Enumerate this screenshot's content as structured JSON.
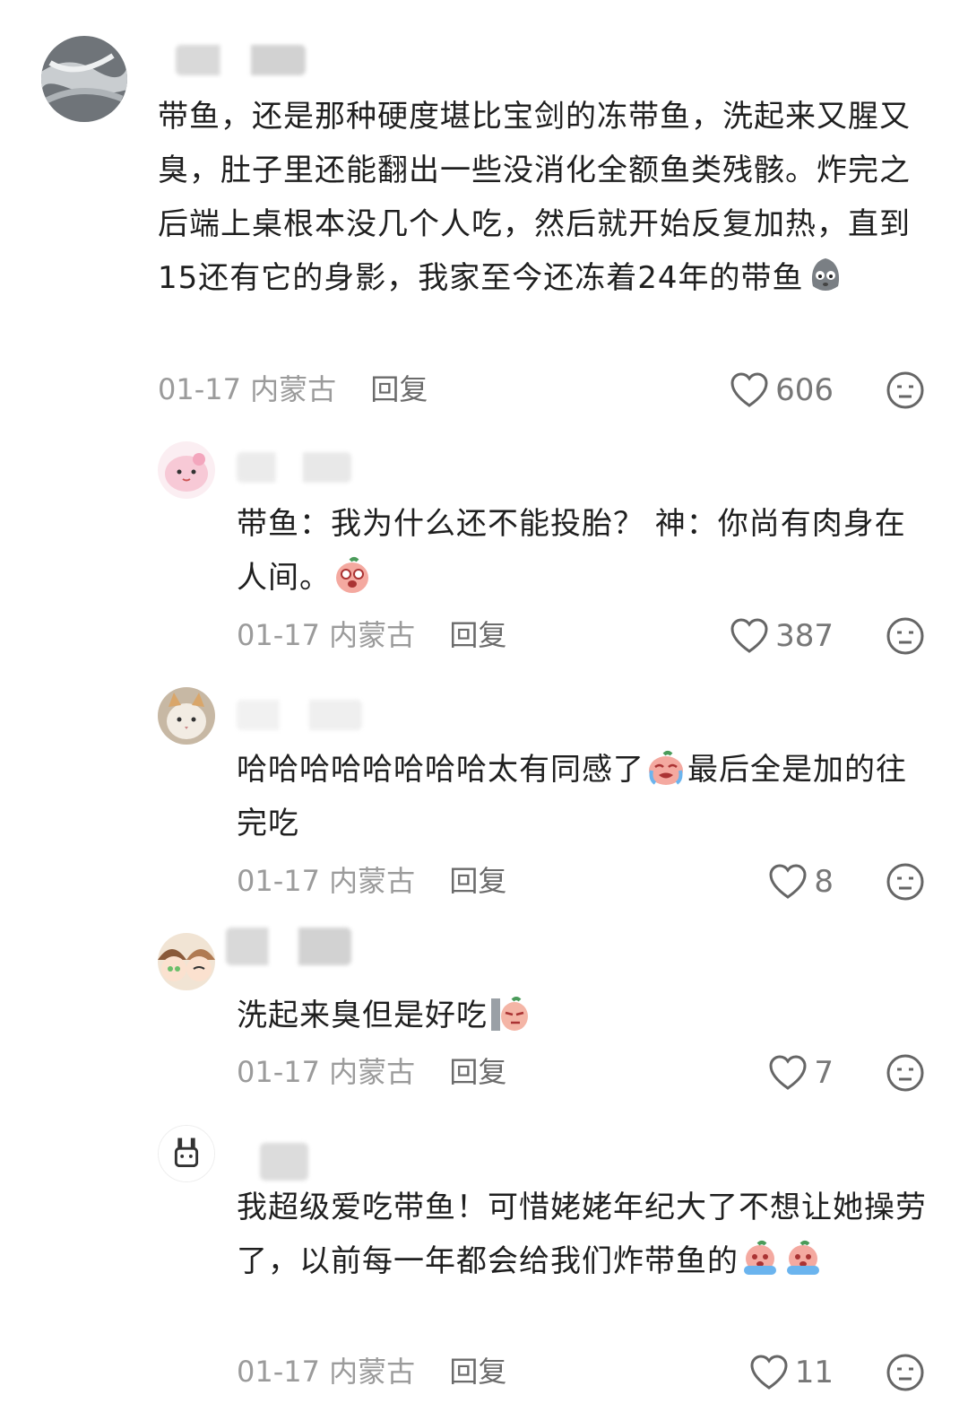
{
  "comments": [
    {
      "text_before": "带鱼，还是那种硬度堪比宝剑的冻带鱼，洗起来又腥又臭，肚子里还能翻出一些没消化全额鱼类残骸。炸完之后端上桌根本没几个人吃，然后就开始反复加热，直到15还有它的身影，我家至今还冻着24年的带鱼",
      "emoji": "worried-face",
      "date": "01-17",
      "location": "内蒙古",
      "reply_label": "回复",
      "likes": "606"
    },
    {
      "text_before": "带鱼：我为什么还不能投胎？ 神：你尚有肉身在人间。",
      "emoji": "shocked-face",
      "date": "01-17",
      "location": "内蒙古",
      "reply_label": "回复",
      "likes": "387"
    },
    {
      "text_before": "哈哈哈哈哈哈哈哈太有同感了",
      "emoji": "crying-face",
      "text_after": "最后全是加的往完吃",
      "date": "01-17",
      "location": "内蒙古",
      "reply_label": "回复",
      "likes": "8"
    },
    {
      "text_before": "洗起来臭但是好吃",
      "emoji": "peeking-face",
      "date": "01-17",
      "location": "内蒙古",
      "reply_label": "回复",
      "likes": "7"
    },
    {
      "text_before": "我超级爱吃带鱼！可惜姥姥年纪大了不想让她操劳了，以前每一年都会给我们炸带鱼的",
      "emoji": "sobbing-face",
      "emoji2": "sobbing-face",
      "date": "01-17",
      "location": "内蒙古",
      "reply_label": "回复",
      "likes": "11"
    }
  ]
}
